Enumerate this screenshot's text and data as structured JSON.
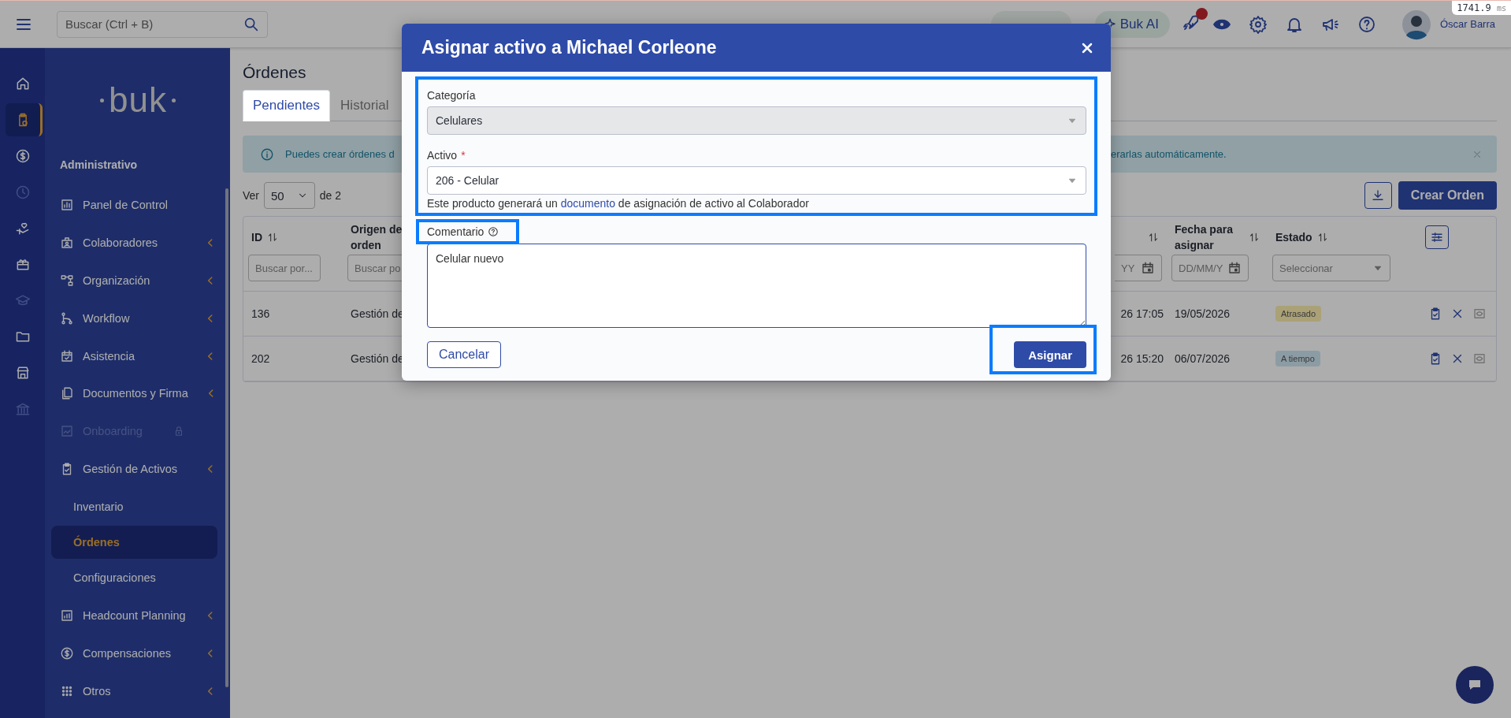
{
  "topbar": {
    "search": {
      "placeholder": "Buscar (Ctrl + B)"
    },
    "ai_button": "Buk AI",
    "notification_dot": true,
    "user_name": "Óscar Barra"
  },
  "timing_badge": {
    "value": "1741.9",
    "unit": "ms"
  },
  "rail": [
    {
      "selected": false,
      "disabled": false
    },
    {
      "selected": true,
      "disabled": false
    },
    {
      "selected": false,
      "disabled": false
    },
    {
      "selected": false,
      "disabled": true
    },
    {
      "selected": false,
      "disabled": false
    },
    {
      "selected": false,
      "disabled": false
    },
    {
      "selected": false,
      "disabled": true
    },
    {
      "selected": false,
      "disabled": false
    },
    {
      "selected": false,
      "disabled": false
    },
    {
      "selected": false,
      "disabled": true
    }
  ],
  "sidebar": {
    "logo": "buk",
    "section": "Administrativo",
    "items": [
      {
        "label": "Panel de Control",
        "expandable": false,
        "disabled": false,
        "locked": false
      },
      {
        "label": "Colaboradores",
        "expandable": true,
        "disabled": false,
        "locked": false
      },
      {
        "label": "Organización",
        "expandable": true,
        "disabled": false,
        "locked": false
      },
      {
        "label": "Workflow",
        "expandable": true,
        "disabled": false,
        "locked": false
      },
      {
        "label": "Asistencia",
        "expandable": true,
        "disabled": false,
        "locked": false
      },
      {
        "label": "Documentos y Firma",
        "expandable": true,
        "disabled": false,
        "locked": false
      },
      {
        "label": "Onboarding",
        "expandable": false,
        "disabled": true,
        "locked": true
      },
      {
        "label": "Gestión de Activos",
        "expandable": true,
        "disabled": false,
        "locked": false,
        "children": [
          {
            "label": "Inventario",
            "selected": false
          },
          {
            "label": "Órdenes",
            "selected": true
          },
          {
            "label": "Configuraciones",
            "selected": false
          }
        ]
      },
      {
        "label": "Headcount Planning",
        "expandable": true,
        "disabled": false,
        "locked": false
      },
      {
        "label": "Compensaciones",
        "expandable": true,
        "disabled": false,
        "locked": false
      },
      {
        "label": "Otros",
        "expandable": true,
        "disabled": false,
        "locked": false
      }
    ]
  },
  "page": {
    "title": "Órdenes",
    "tabs": [
      {
        "label": "Pendientes",
        "selected": true
      },
      {
        "label": "Historial",
        "selected": false
      }
    ],
    "banner": {
      "text_left": "Puedes crear órdenes d",
      "text_right": "erarlas automáticamente."
    },
    "page_size": {
      "label": "Ver",
      "value": "50",
      "suffix": "de 2"
    },
    "create_button": "Crear Orden",
    "table": {
      "columns": [
        {
          "label": "ID",
          "sortable": true
        },
        {
          "label": "Origen de orden"
        },
        {
          "sortable": true
        },
        {
          "label": "Fecha para asignar",
          "sortable": true
        },
        {
          "label": "Estado",
          "sortable": true
        }
      ],
      "filters": [
        {
          "kind": "text",
          "placeholder": "Buscar por..."
        },
        {
          "kind": "text",
          "placeholder": "Buscar po"
        },
        {
          "kind": "date",
          "placeholder": "YY"
        },
        {
          "kind": "date",
          "placeholder": "DD/MM/Y"
        },
        {
          "kind": "select",
          "placeholder": "Seleccionar"
        }
      ],
      "rows": [
        {
          "id": "136",
          "origin": "Gestión de",
          "column_3": "26 17:05",
          "assign_date": "19/05/2026",
          "status": {
            "label": "Atrasado",
            "kind": "late"
          }
        },
        {
          "id": "202",
          "origin": "Gestión de",
          "column_3": "26 15:20",
          "assign_date": "06/07/2026",
          "status": {
            "label": "A tiempo",
            "kind": "on_time"
          }
        }
      ]
    }
  },
  "dialog": {
    "title": "Asignar activo a Michael Corleone",
    "category": {
      "label": "Categoría",
      "value": "Celulares",
      "disabled": true
    },
    "asset": {
      "label": "Activo",
      "required_mark": "*",
      "value": "206 - Celular"
    },
    "helper": {
      "before": "Este producto generará un",
      "link": "documento",
      "after": "de asignación de activo al Colaborador"
    },
    "comment": {
      "label": "Comentario",
      "value": "Celular nuevo"
    },
    "cancel_button": "Cancelar",
    "submit_button": "Asignar"
  }
}
